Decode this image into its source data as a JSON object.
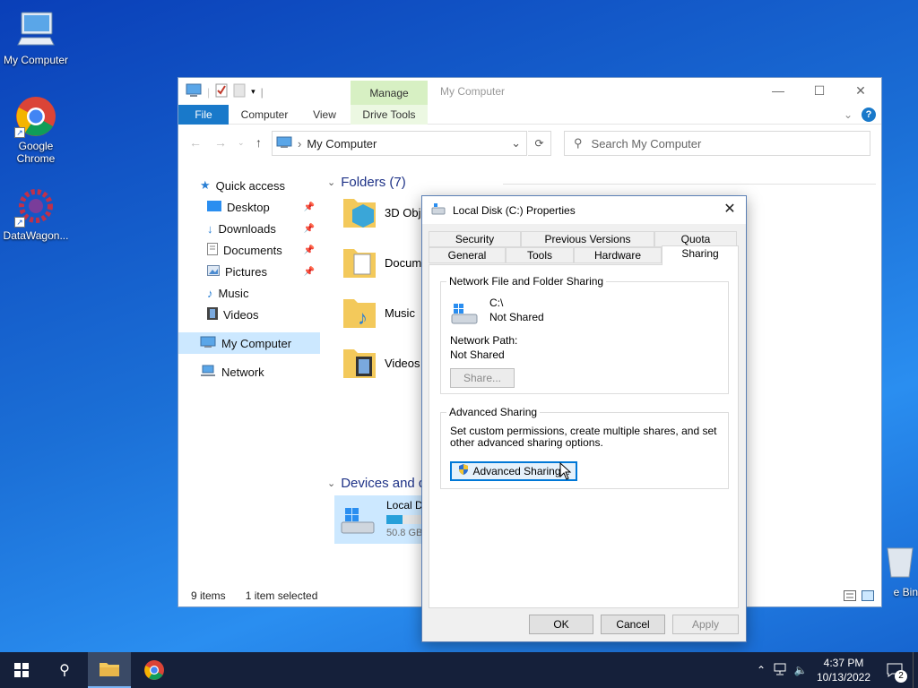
{
  "desktop": {
    "icons": [
      {
        "label": "My Computer"
      },
      {
        "label": "Google Chrome"
      },
      {
        "label": "DataWagon..."
      },
      {
        "label": "e Bin"
      }
    ]
  },
  "explorer": {
    "manage_tab": "Manage",
    "title": "My Computer",
    "ribbon_tabs": [
      "File",
      "Computer",
      "View",
      "Drive Tools"
    ],
    "address": "My Computer",
    "search_placeholder": "Search My Computer",
    "nav": {
      "quick_access": "Quick access",
      "items": [
        "Desktop",
        "Downloads",
        "Documents",
        "Pictures",
        "Music",
        "Videos"
      ],
      "my_computer": "My Computer",
      "network": "Network"
    },
    "folders_header": "Folders (7)",
    "folders": [
      "3D Obje",
      "Docum",
      "Music",
      "Videos"
    ],
    "devices_header": "Devices and d",
    "drive": {
      "name": "Local Di",
      "free": "50.8 GB",
      "usage_fraction": 0.35
    },
    "status": {
      "items": "9 items",
      "selected": "1 item selected"
    }
  },
  "dialog": {
    "title": "Local Disk (C:) Properties",
    "tabs_row1": [
      "Security",
      "Previous Versions",
      "Quota"
    ],
    "tabs_row2": [
      "General",
      "Tools",
      "Hardware",
      "Sharing"
    ],
    "network_sharing": {
      "group_title": "Network File and Folder Sharing",
      "drive": "C:\\",
      "drive_status": "Not Shared",
      "path_label": "Network Path:",
      "path_value": "Not Shared",
      "share_button": "Share..."
    },
    "advanced": {
      "group_title": "Advanced Sharing",
      "description": "Set custom permissions, create multiple shares, and set other advanced sharing options.",
      "button": "Advanced Sharing..."
    },
    "buttons": {
      "ok": "OK",
      "cancel": "Cancel",
      "apply": "Apply"
    }
  },
  "taskbar": {
    "time": "4:37 PM",
    "date": "10/13/2022",
    "notification_count": "2"
  },
  "colors": {
    "accent": "#0078d7",
    "file_tab": "#1979ca",
    "manage_tab": "#d7f0c3",
    "selection": "#cce8ff",
    "taskbar": "#15203a"
  }
}
